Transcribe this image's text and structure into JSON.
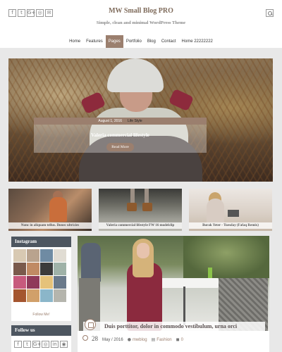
{
  "header": {
    "title": "MW Small Blog PRO",
    "tagline": "Simple, clean and minimal WordPress Theme",
    "social_icons": [
      "facebook-icon",
      "twitter-icon",
      "google-plus-icon",
      "instagram-icon",
      "email-icon"
    ],
    "social_glyphs": [
      "f",
      "t",
      "G+",
      "◎",
      "✉"
    ]
  },
  "nav": {
    "items": [
      "Home",
      "Features",
      "Pages",
      "Portfolio",
      "Blog",
      "Contact",
      "Home 22222222"
    ],
    "active": "Pages"
  },
  "hero": {
    "date": "August 1, 2016",
    "category": "Life Style",
    "title": "Valeria commercial lifestyle",
    "button": "Read More"
  },
  "thumbs": [
    {
      "caption": "Nunc in aliquam tellus. Donec ultricies"
    },
    {
      "caption": "Valeria commercial lifestyle FW 16 modelclip"
    },
    {
      "caption": "Burak Yeter - Tuesday (Fafaq Remix)"
    }
  ],
  "sidebar": {
    "instagram_title": "Instagram",
    "follow_link": "Follow Me!",
    "follow_title": "Follow us",
    "follow_glyphs": [
      "f",
      "t",
      "G+",
      "◎",
      "in",
      "◉",
      "▶",
      "◈",
      "✉"
    ],
    "insta_colors": [
      "#d8c9b2",
      "#b9a38e",
      "#6f8ba3",
      "#e0dcd3",
      "#7a5a4c",
      "#c08a64",
      "#3b3b3b",
      "#9fb2a8",
      "#c75a7d",
      "#8f3a5a",
      "#e5c27a",
      "#6a7a8b",
      "#a4552f",
      "#d1a06a",
      "#8bb6c9",
      "#b5b5ad"
    ]
  },
  "post": {
    "title": "Duis porttitor, dolor in commodo vestibulum, urna orci",
    "day": "28",
    "month_year": "May / 2016",
    "author": "mwblog",
    "category": "Fashion",
    "comments": "0"
  },
  "colors": {
    "accent": "#9b7f6e",
    "widget_header": "#4d5660"
  }
}
